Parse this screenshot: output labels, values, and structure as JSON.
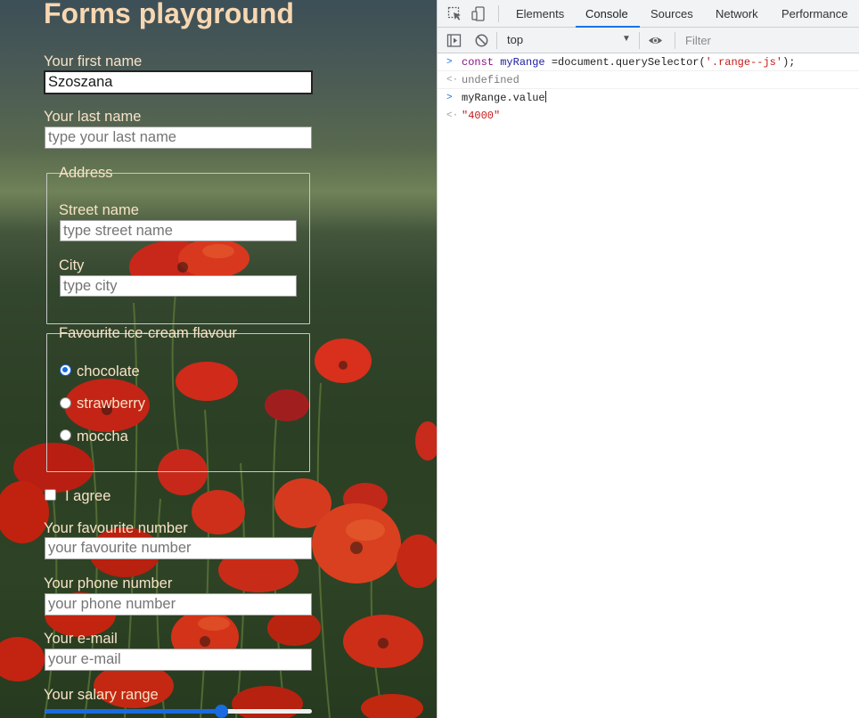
{
  "page": {
    "title": "Forms playground",
    "first_name": {
      "label": "Your first name",
      "value": "Szoszana"
    },
    "last_name": {
      "label": "Your last name",
      "placeholder": "type your last name"
    },
    "address": {
      "legend": "Address",
      "street": {
        "label": "Street name",
        "placeholder": "type street name"
      },
      "city": {
        "label": "City",
        "placeholder": "type city"
      }
    },
    "flavour": {
      "legend": "Favourite ice-cream flavour",
      "options": [
        {
          "label": "chocolate",
          "checked": true
        },
        {
          "label": "strawberry",
          "checked": false
        },
        {
          "label": "moccha",
          "checked": false
        }
      ]
    },
    "agree": {
      "label": "I agree",
      "checked": false
    },
    "fav_number": {
      "label": "Your favourite number",
      "placeholder": "your favourite number"
    },
    "phone": {
      "label": "Your phone number",
      "placeholder": "your phone number"
    },
    "email": {
      "label": "Your e-mail",
      "placeholder": "your e-mail"
    },
    "salary": {
      "label": "Your salary range",
      "fraction": 0.66
    },
    "accent_color": "#1a6be0"
  },
  "devtools": {
    "tabs": [
      "Elements",
      "Console",
      "Sources",
      "Network",
      "Performance"
    ],
    "active_tab": "Console",
    "context": "top",
    "filter_placeholder": "Filter",
    "icons": [
      "inspect-icon",
      "device-toggle-icon",
      "sidebar-toggle-icon",
      "clear-console-icon",
      "eye-icon"
    ],
    "console": [
      {
        "type": "input",
        "kw": "const",
        "var": "myRange",
        "rest": " =document.querySelector(",
        "str": "'.range--js'",
        "end": ");"
      },
      {
        "type": "output",
        "text": "undefined"
      },
      {
        "type": "input",
        "text": "myRange.value"
      },
      {
        "type": "output-string",
        "text": "\"4000\""
      }
    ]
  }
}
